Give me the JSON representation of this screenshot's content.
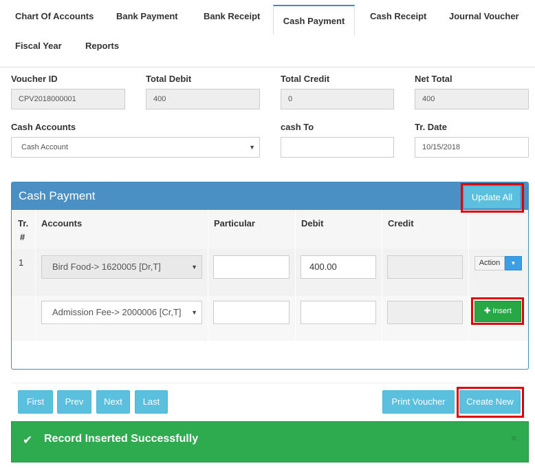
{
  "tabs": [
    {
      "label": "Chart Of Accounts",
      "active": false
    },
    {
      "label": "Bank Payment",
      "active": false
    },
    {
      "label": "Bank Receipt",
      "active": false
    },
    {
      "label": "Cash Payment",
      "active": true
    },
    {
      "label": "Cash Receipt",
      "active": false
    },
    {
      "label": "Journal Voucher",
      "active": false
    },
    {
      "label": "Fiscal Year",
      "active": false
    },
    {
      "label": "Reports",
      "active": false
    }
  ],
  "form": {
    "voucher_id_label": "Voucher ID",
    "voucher_id_value": "CPV2018000001",
    "total_debit_label": "Total Debit",
    "total_debit_value": "400",
    "total_credit_label": "Total Credit",
    "total_credit_value": "0",
    "net_total_label": "Net Total",
    "net_total_value": "400",
    "cash_accounts_label": "Cash Accounts",
    "cash_accounts_value": "Cash Account",
    "cash_to_label": "cash To",
    "cash_to_value": "",
    "tr_date_label": "Tr. Date",
    "tr_date_value": "10/15/2018"
  },
  "panel": {
    "title": "Cash Payment",
    "update_all_label": "Update All",
    "columns": {
      "tr_line1": "Tr.",
      "tr_line2": "#",
      "accounts": "Accounts",
      "particular": "Particular",
      "debit": "Debit",
      "credit": "Credit"
    },
    "rows": [
      {
        "tr": "1",
        "account": "Bird Food-> 1620005 [Dr,T]",
        "particular": "",
        "debit": "400.00",
        "credit": "",
        "action_label": "Action"
      },
      {
        "tr": "",
        "account": "Admission Fee-> 2000006 [Cr,T]",
        "particular": "",
        "debit": "",
        "credit": "",
        "insert_label": "Insert"
      }
    ]
  },
  "pager": {
    "first": "First",
    "prev": "Prev",
    "next": "Next",
    "last": "Last",
    "print_voucher": "Print Voucher",
    "create_new": "Create New"
  },
  "alert": {
    "message": "Record Inserted Successfully",
    "close": "×"
  },
  "colors": {
    "accent": "#3c8dbc",
    "info": "#5bc0de",
    "success": "#28a745",
    "highlight": "#e00000"
  }
}
